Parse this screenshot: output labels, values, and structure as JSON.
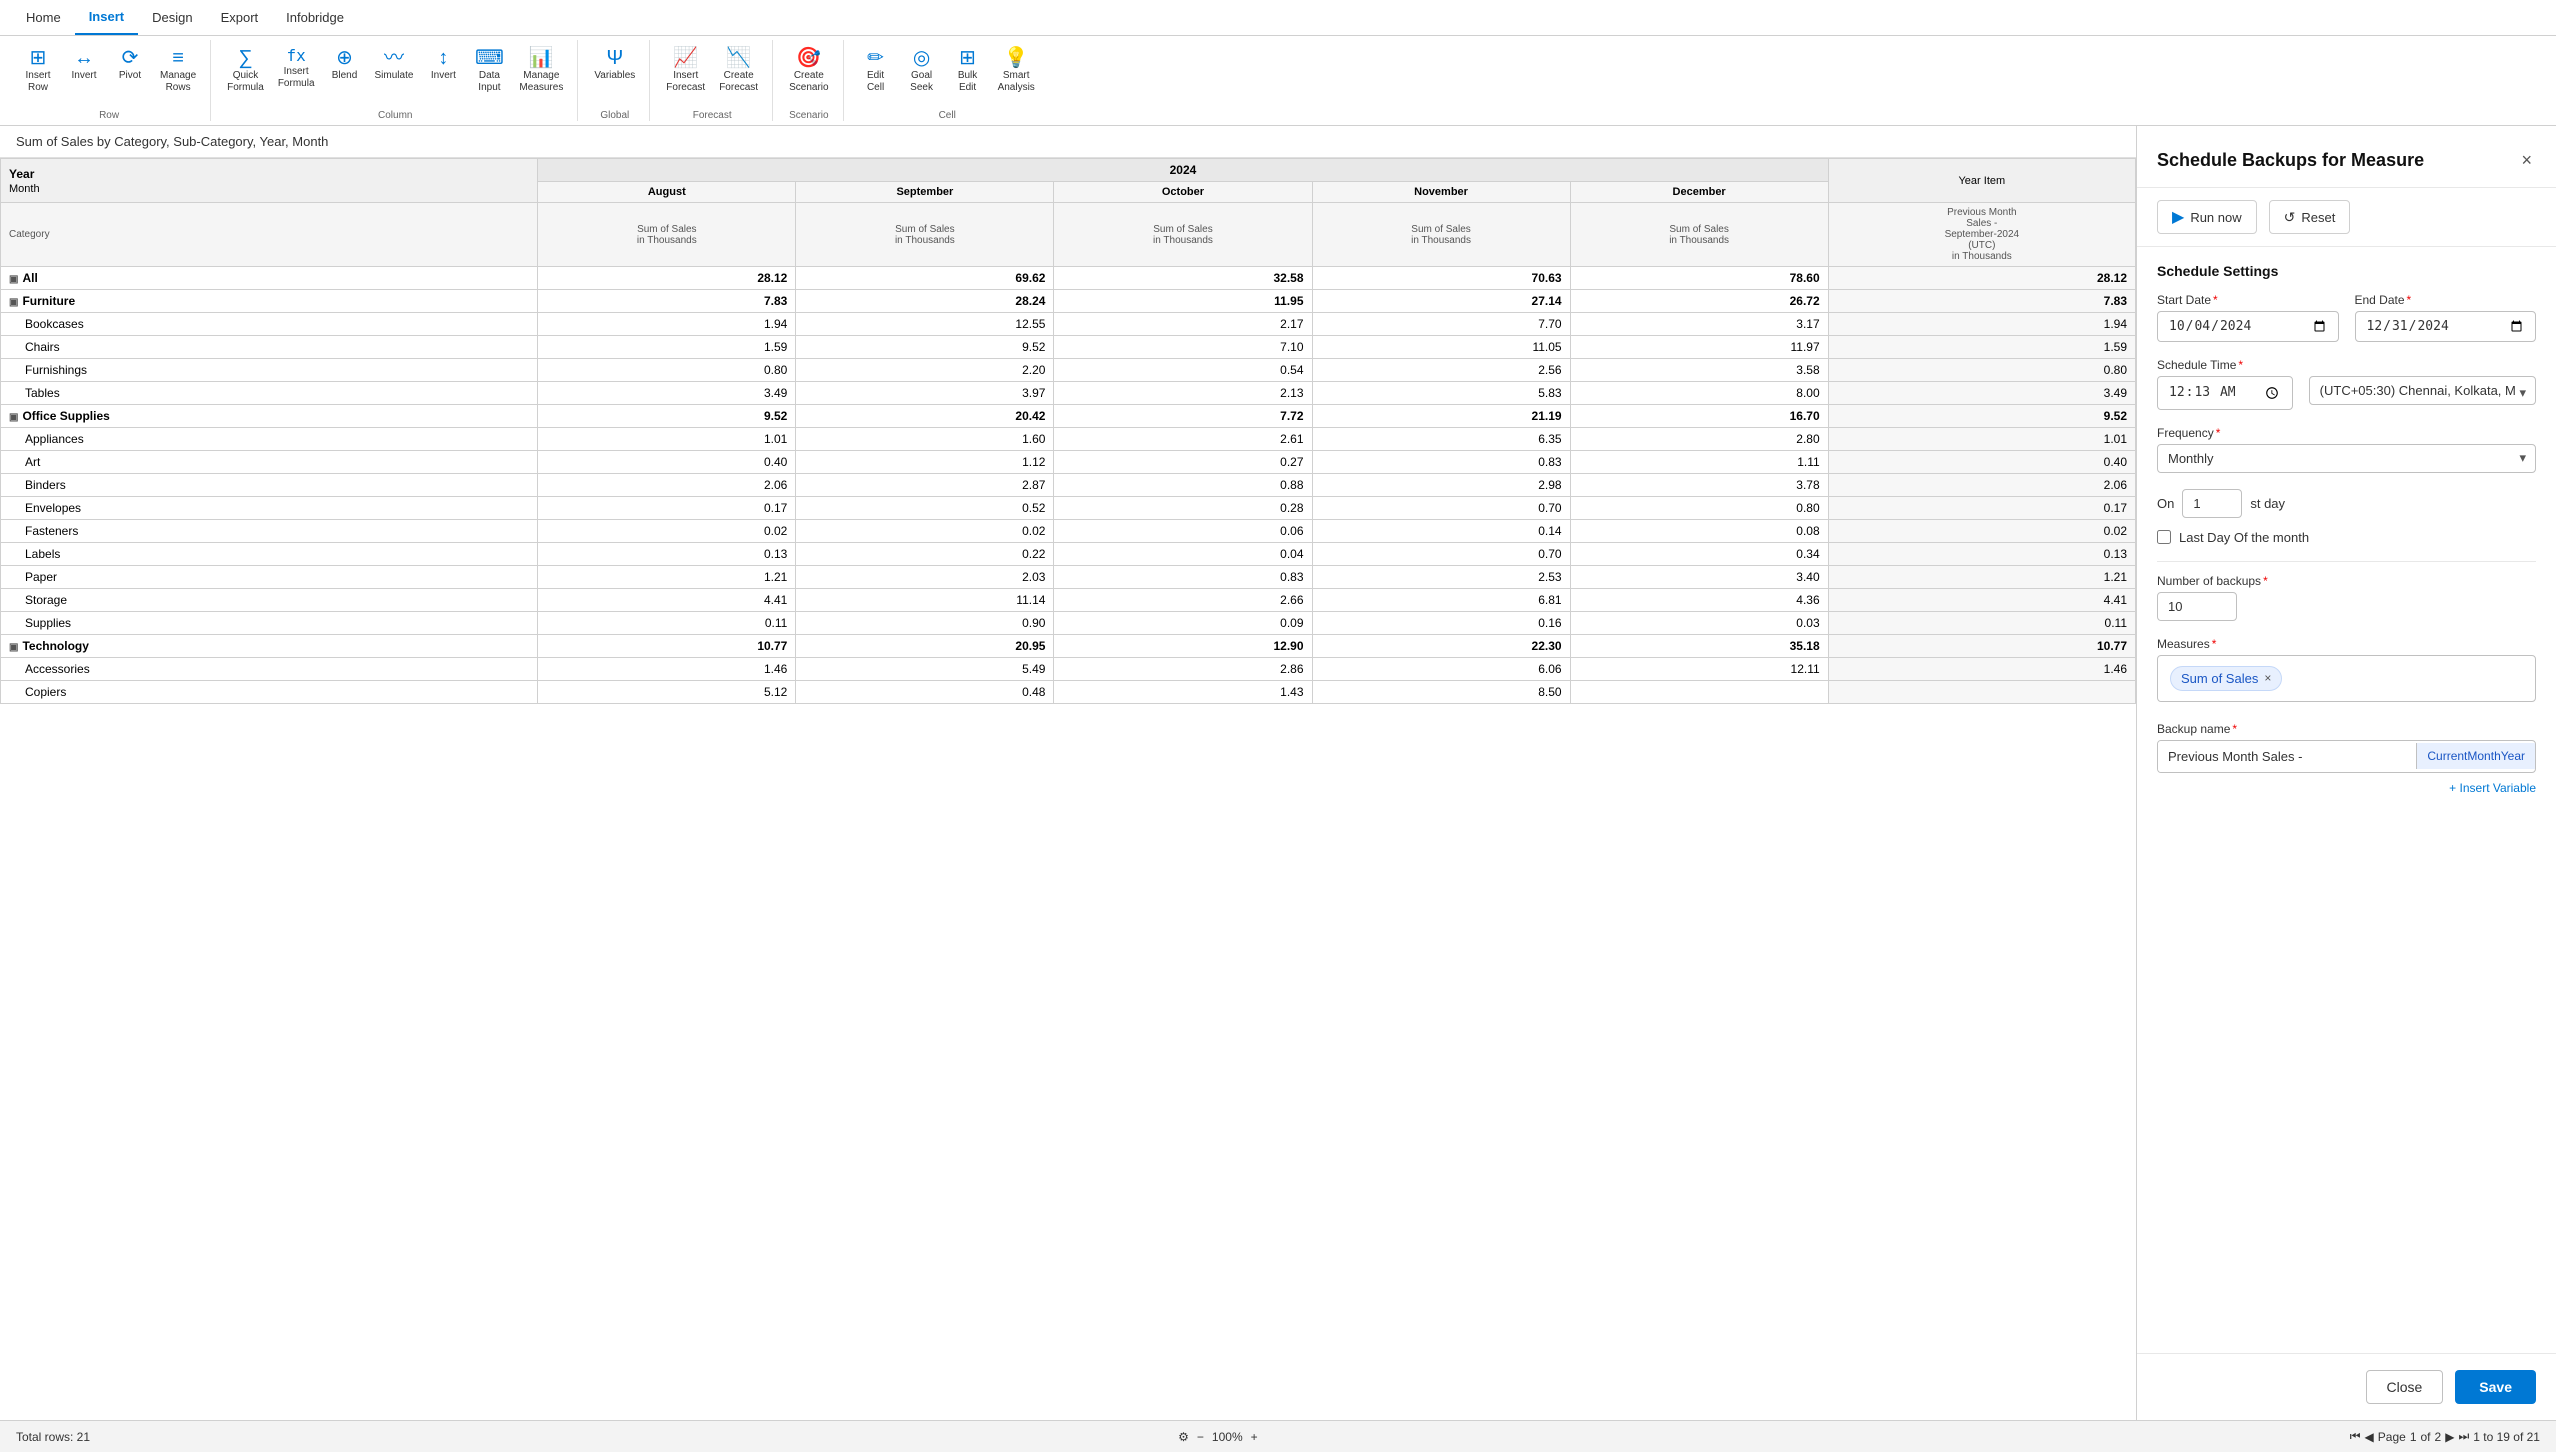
{
  "nav": {
    "items": [
      "Home",
      "Insert",
      "Design",
      "Export",
      "Infobridge"
    ],
    "active": "Insert"
  },
  "ribbon": {
    "groups": [
      {
        "label": "Row",
        "buttons": [
          {
            "id": "insert-row",
            "icon": "⊞",
            "label": "Insert\nRow"
          },
          {
            "id": "invert",
            "icon": "↔",
            "label": "Invert"
          },
          {
            "id": "pivot",
            "icon": "⟳",
            "label": "Pivot"
          },
          {
            "id": "manage-rows",
            "icon": "≡",
            "label": "Manage\nRows"
          }
        ]
      },
      {
        "label": "Column",
        "buttons": [
          {
            "id": "quick-formula",
            "icon": "∑",
            "label": "Quick\nFormula"
          },
          {
            "id": "insert-formula",
            "icon": "fx",
            "label": "Insert\nFormula"
          },
          {
            "id": "blend",
            "icon": "⊕",
            "label": "Blend"
          },
          {
            "id": "simulate",
            "icon": "~",
            "label": "Simulate"
          },
          {
            "id": "invert2",
            "icon": "↕",
            "label": "Invert"
          },
          {
            "id": "data-input",
            "icon": "⌨",
            "label": "Data\nInput"
          },
          {
            "id": "manage-measures",
            "icon": "📊",
            "label": "Manage\nMeasures"
          }
        ]
      },
      {
        "label": "Global",
        "buttons": [
          {
            "id": "variables",
            "icon": "Ψ",
            "label": "Variables"
          }
        ]
      },
      {
        "label": "Forecast",
        "buttons": [
          {
            "id": "insert-forecast",
            "icon": "📈",
            "label": "Insert\nForecast"
          },
          {
            "id": "create-forecast",
            "icon": "📉",
            "label": "Create\nForecast"
          }
        ]
      },
      {
        "label": "Scenario",
        "buttons": [
          {
            "id": "create-scenario",
            "icon": "🎯",
            "label": "Create\nScenario"
          }
        ]
      },
      {
        "label": "Cell",
        "buttons": [
          {
            "id": "edit-cell",
            "icon": "✏",
            "label": "Edit\nCell"
          },
          {
            "id": "goal-seek",
            "icon": "◎",
            "label": "Goal\nSeek"
          },
          {
            "id": "bulk-edit",
            "icon": "⊞",
            "label": "Bulk\nEdit"
          },
          {
            "id": "smart-analysis",
            "icon": "💡",
            "label": "Smart\nAnalysis"
          }
        ]
      }
    ]
  },
  "sheet": {
    "title": "Sum of Sales by Category, Sub-Category, Year, Month",
    "table": {
      "year": "2024",
      "year_item_label": "Year Item",
      "row_header_1": "Year",
      "row_header_2": "Month",
      "row_header_3": "Category",
      "months": [
        "August",
        "September",
        "October",
        "November",
        "December"
      ],
      "col_sub": "Sum of Sales\nin Thousands",
      "year_item_col_label": "Previous Month Sales - September-2024 (UTC)\nin Thousands",
      "rows": [
        {
          "label": "All",
          "indent": 0,
          "expandable": true,
          "bold": true,
          "values": [
            "28.12",
            "69.62",
            "32.58",
            "70.63",
            "78.60"
          ],
          "year_item": "28.12"
        },
        {
          "label": "Furniture",
          "indent": 0,
          "expandable": true,
          "bold": true,
          "values": [
            "7.83",
            "28.24",
            "11.95",
            "27.14",
            "26.72"
          ],
          "year_item": "7.83"
        },
        {
          "label": "Bookcases",
          "indent": 1,
          "expandable": false,
          "bold": false,
          "values": [
            "1.94",
            "12.55",
            "2.17",
            "7.70",
            "3.17"
          ],
          "year_item": "1.94"
        },
        {
          "label": "Chairs",
          "indent": 1,
          "expandable": false,
          "bold": false,
          "values": [
            "1.59",
            "9.52",
            "7.10",
            "11.05",
            "11.97"
          ],
          "year_item": "1.59"
        },
        {
          "label": "Furnishings",
          "indent": 1,
          "expandable": false,
          "bold": false,
          "values": [
            "0.80",
            "2.20",
            "0.54",
            "2.56",
            "3.58"
          ],
          "year_item": "0.80"
        },
        {
          "label": "Tables",
          "indent": 1,
          "expandable": false,
          "bold": false,
          "values": [
            "3.49",
            "3.97",
            "2.13",
            "5.83",
            "8.00"
          ],
          "year_item": "3.49"
        },
        {
          "label": "Office Supplies",
          "indent": 0,
          "expandable": true,
          "bold": true,
          "values": [
            "9.52",
            "20.42",
            "7.72",
            "21.19",
            "16.70"
          ],
          "year_item": "9.52"
        },
        {
          "label": "Appliances",
          "indent": 1,
          "expandable": false,
          "bold": false,
          "values": [
            "1.01",
            "1.60",
            "2.61",
            "6.35",
            "2.80"
          ],
          "year_item": "1.01"
        },
        {
          "label": "Art",
          "indent": 1,
          "expandable": false,
          "bold": false,
          "values": [
            "0.40",
            "1.12",
            "0.27",
            "0.83",
            "1.11"
          ],
          "year_item": "0.40"
        },
        {
          "label": "Binders",
          "indent": 1,
          "expandable": false,
          "bold": false,
          "values": [
            "2.06",
            "2.87",
            "0.88",
            "2.98",
            "3.78"
          ],
          "year_item": "2.06"
        },
        {
          "label": "Envelopes",
          "indent": 1,
          "expandable": false,
          "bold": false,
          "values": [
            "0.17",
            "0.52",
            "0.28",
            "0.70",
            "0.80"
          ],
          "year_item": "0.17"
        },
        {
          "label": "Fasteners",
          "indent": 1,
          "expandable": false,
          "bold": false,
          "values": [
            "0.02",
            "0.02",
            "0.06",
            "0.14",
            "0.08"
          ],
          "year_item": "0.02"
        },
        {
          "label": "Labels",
          "indent": 1,
          "expandable": false,
          "bold": false,
          "values": [
            "0.13",
            "0.22",
            "0.04",
            "0.70",
            "0.34"
          ],
          "year_item": "0.13"
        },
        {
          "label": "Paper",
          "indent": 1,
          "expandable": false,
          "bold": false,
          "values": [
            "1.21",
            "2.03",
            "0.83",
            "2.53",
            "3.40"
          ],
          "year_item": "1.21"
        },
        {
          "label": "Storage",
          "indent": 1,
          "expandable": false,
          "bold": false,
          "values": [
            "4.41",
            "11.14",
            "2.66",
            "6.81",
            "4.36"
          ],
          "year_item": "4.41"
        },
        {
          "label": "Supplies",
          "indent": 1,
          "expandable": false,
          "bold": false,
          "values": [
            "0.11",
            "0.90",
            "0.09",
            "0.16",
            "0.03"
          ],
          "year_item": "0.11"
        },
        {
          "label": "Technology",
          "indent": 0,
          "expandable": true,
          "bold": true,
          "values": [
            "10.77",
            "20.95",
            "12.90",
            "22.30",
            "35.18"
          ],
          "year_item": "10.77"
        },
        {
          "label": "Accessories",
          "indent": 1,
          "expandable": false,
          "bold": false,
          "values": [
            "1.46",
            "5.49",
            "2.86",
            "6.06",
            "12.11"
          ],
          "year_item": "1.46"
        },
        {
          "label": "Copiers",
          "indent": 1,
          "expandable": false,
          "bold": false,
          "values": [
            "5.12",
            "0.48",
            "1.43",
            "8.50",
            ""
          ],
          "year_item": ""
        }
      ]
    }
  },
  "status": {
    "total_rows": "Total rows: 21",
    "zoom": "100%",
    "page_current": "1",
    "page_total": "2",
    "page_range": "1 to 19 of 21"
  },
  "panel": {
    "title": "Schedule Backups for Measure",
    "close_label": "×",
    "run_now_label": "Run now",
    "reset_label": "Reset",
    "settings_title": "Schedule Settings",
    "start_date_label": "Start Date",
    "start_date_value": "10/04/2024",
    "end_date_label": "End Date",
    "end_date_value": "12/31/2024",
    "schedule_time_label": "Schedule Time",
    "schedule_time_value": "12:13 AM",
    "timezone_value": "(UTC+05:30) Chennai, Kolkata, M",
    "frequency_label": "Frequency",
    "frequency_value": "Monthly",
    "on_label": "On",
    "on_day_value": "1",
    "on_suffix": "st day",
    "last_day_label": "Last Day Of the month",
    "num_backups_label": "Number of backups",
    "num_backups_value": "10",
    "measures_label": "Measures",
    "measure_chip": "Sum of Sales",
    "backup_name_label": "Backup name",
    "backup_name_value": "Previous Month Sales - ",
    "backup_name_variable": "CurrentMonthYear",
    "insert_variable_label": "+ Insert Variable",
    "close_btn": "Close",
    "save_btn": "Save"
  }
}
